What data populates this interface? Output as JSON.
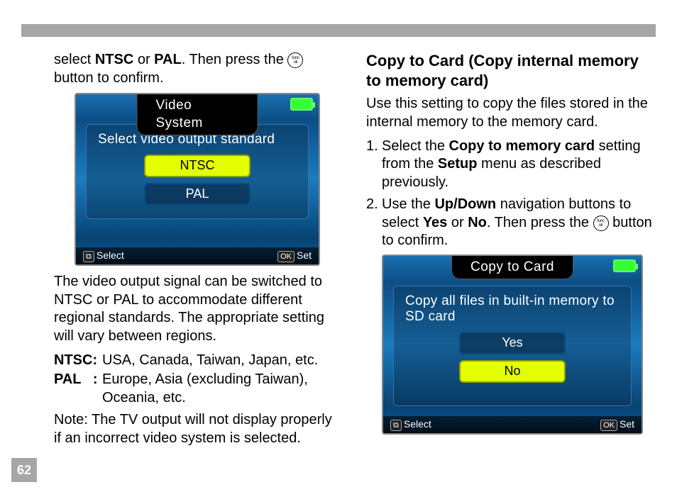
{
  "page_number": "62",
  "left": {
    "intro_pre": "select ",
    "intro_b1": "NTSC",
    "intro_mid": " or ",
    "intro_b2": "PAL",
    "intro_post": ". Then press the ",
    "intro_tail": " button to confirm.",
    "lcd1": {
      "title": "Video System",
      "prompt": "Select video output standard",
      "options": [
        "NTSC",
        "PAL"
      ],
      "selected_index": 0,
      "footer_left_key": "⧉",
      "footer_left": "Select",
      "footer_right_key": "OK",
      "footer_right": "Set"
    },
    "explain": "The video output signal can be switched to NTSC or PAL to accommodate different regional standards. The appropriate setting will vary between regions.",
    "ntsc_label": "NTSC:",
    "ntsc_regions": "USA, Canada, Taiwan, Japan, etc.",
    "pal_label": "PAL   :",
    "pal_regions": "Europe, Asia (excluding Taiwan), Oceania, etc.",
    "note": "Note: The TV output will not display properly if an incorrect video system is selected."
  },
  "right": {
    "heading": "Copy to Card (Copy internal memory to memory card)",
    "intro": "Use this setting to copy the files stored in the internal memory to the memory card.",
    "step1_num": "1.",
    "step1_a": "Select the ",
    "step1_b": "Copy to memory card",
    "step1_c": " setting from the ",
    "step1_d": "Setup",
    "step1_e": " menu as described previously.",
    "step2_num": "2.",
    "step2_a": "Use the ",
    "step2_b": "Up/Down",
    "step2_c": " navigation buttons to select ",
    "step2_d": "Yes",
    "step2_e": " or ",
    "step2_f": "No",
    "step2_g": ". Then press the ",
    "step2_h": " button to confirm.",
    "lcd2": {
      "title": "Copy to Card",
      "prompt": "Copy all files in built-in memory to SD card",
      "options": [
        "Yes",
        "No"
      ],
      "selected_index": 1,
      "footer_left_key": "⧉",
      "footer_left": "Select",
      "footer_right_key": "OK",
      "footer_right": "Set"
    }
  },
  "func_ok": {
    "line1": "func",
    "line2": "ok"
  }
}
